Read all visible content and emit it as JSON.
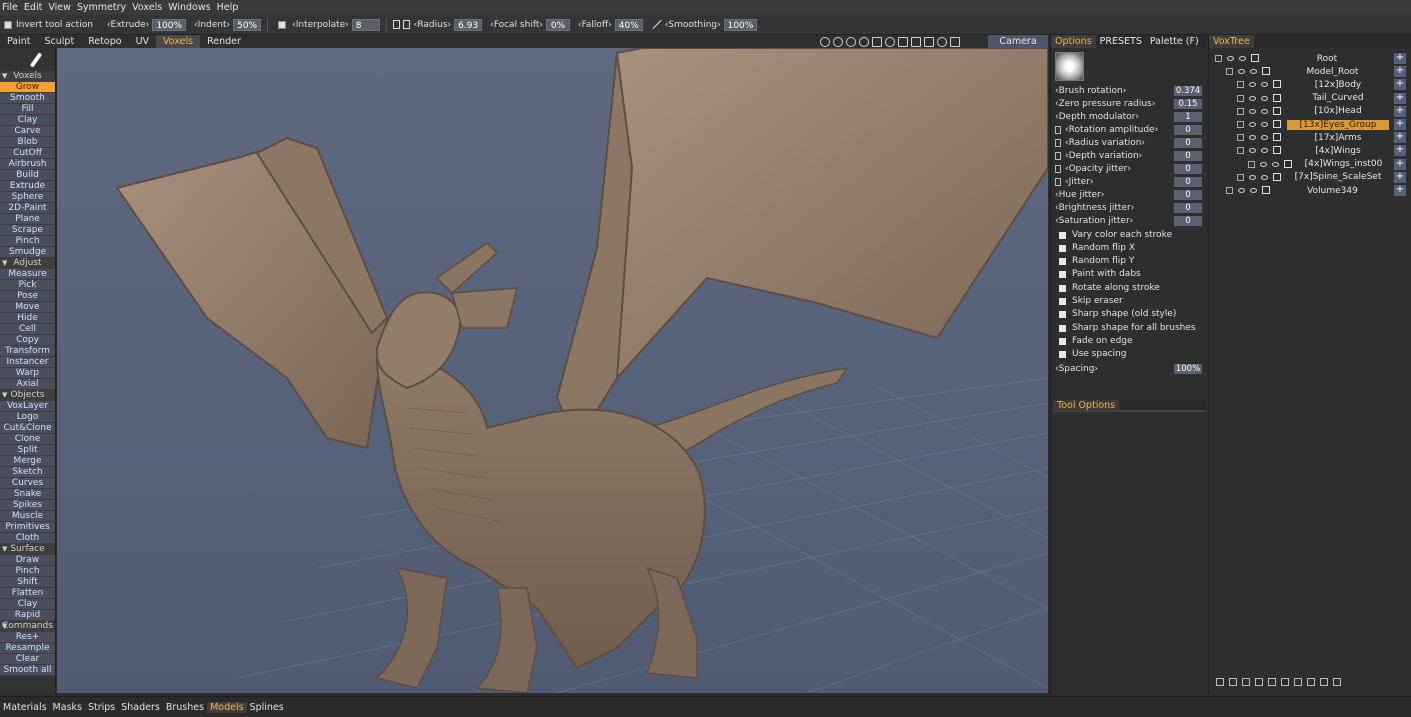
{
  "menu": [
    "File",
    "Edit",
    "View",
    "Symmetry",
    "Voxels",
    "Windows",
    "Help"
  ],
  "toolbar": {
    "invert_label": "Invert tool action",
    "extrude_label": "‹Extrude›",
    "extrude_value": "100%",
    "indent_label": "‹Indent›",
    "indent_value": "50%",
    "interpolate_label": "‹Interpolate›",
    "interpolate_value": "8",
    "radius_label": "‹Radius›",
    "radius_value": "6.93",
    "focal_label": "‹Focal shift›",
    "focal_value": "0%",
    "falloff_label": "‹Falloff›",
    "falloff_value": "40%",
    "smoothing_label": "‹Smoothing›",
    "smoothing_value": "100%"
  },
  "rooms": [
    "Paint",
    "Sculpt",
    "Retopo",
    "UV",
    "Voxels",
    "Render"
  ],
  "active_room": "Voxels",
  "camera_label": "Camera",
  "tools": {
    "voxels_header": "Voxels",
    "voxels": [
      "Grow",
      "Smooth",
      "Fill",
      "Clay",
      "Carve",
      "Blob",
      "CutOff",
      "Airbrush",
      "Build",
      "Extrude",
      "Sphere",
      "2D-Paint",
      "Plane",
      "Scrape",
      "Pinch",
      "Smudge"
    ],
    "adjust_header": "Adjust",
    "adjust": [
      "Measure",
      "Pick",
      "Pose",
      "Move",
      "Hide",
      "Cell",
      "Copy",
      "Transform",
      "Instancer",
      "Warp",
      "Axial"
    ],
    "objects_header": "Objects",
    "objects": [
      "VoxLayer",
      "Logo",
      "Cut&Clone",
      "Clone",
      "Split",
      "Merge",
      "Sketch",
      "Curves",
      "Snake",
      "Spikes",
      "Muscle",
      "Primitives",
      "Cloth"
    ],
    "surface_header": "Surface",
    "surface": [
      "Draw",
      "Pinch",
      "Shift",
      "Flatten",
      "Clay",
      "Rapid"
    ],
    "commands_header": "Commands",
    "commands": [
      "Res+",
      "Resample",
      "Clear",
      "Smooth all"
    ],
    "selected": "Grow"
  },
  "options": {
    "tabs": [
      "Options",
      "PRESETS",
      "Palette (F)"
    ],
    "brush_rotation": {
      "label": "‹Brush rotation›",
      "value": "0.374"
    },
    "zero_pressure": {
      "label": "‹Zero pressure radius›",
      "value": "0.15"
    },
    "depth_modulator": {
      "label": "‹Depth modulator›",
      "value": "1"
    },
    "rotation_amplitude": {
      "label": "‹Rotation amplitude›",
      "value": "0"
    },
    "radius_variation": {
      "label": "‹Radius variation›",
      "value": "0"
    },
    "depth_variation": {
      "label": "‹Depth variation›",
      "value": "0"
    },
    "opacity_jitter": {
      "label": "‹Opacity jitter›",
      "value": "0"
    },
    "jitter": {
      "label": "‹Jitter›",
      "value": "0"
    },
    "hue_jitter": {
      "label": "‹Hue jitter›",
      "value": "0"
    },
    "brightness_jitter": {
      "label": "‹Brightness jitter›",
      "value": "0"
    },
    "saturation_jitter": {
      "label": "‹Saturation jitter›",
      "value": "0"
    },
    "checks": [
      "Vary color each stroke",
      "Random flip X",
      "Random flip Y",
      "Paint with dabs",
      "Rotate along stroke",
      "Skip eraser",
      "Sharp shape (old style)",
      "Sharp shape for all brushes",
      "Fade on edge",
      "Use spacing"
    ],
    "spacing": {
      "label": "‹Spacing›",
      "value": "100%"
    },
    "tool_options_tab": "Tool Options"
  },
  "voxtree": {
    "tab": "VoxTree",
    "items": [
      "Root",
      "Model_Root",
      "[12x]Body",
      "Tail_Curved",
      "[10x]Head",
      "[13x]Eyes_Group",
      "[17x]Arms",
      "[4x]Wings",
      "[4x]Wings_inst00",
      "[7x]Spine_ScaleSet",
      "Volume349"
    ],
    "selected": "[13x]Eyes_Group"
  },
  "bottom_tabs": [
    "Materials",
    "Masks",
    "Strips",
    "Shaders",
    "Brushes",
    "Models",
    "Splines"
  ],
  "active_bottom_tab": "Models",
  "colors": {
    "accent": "#f0a033",
    "tool_button": "#4a4f5b",
    "viewport_bg": "#5a657c",
    "model": "#8a7562"
  }
}
